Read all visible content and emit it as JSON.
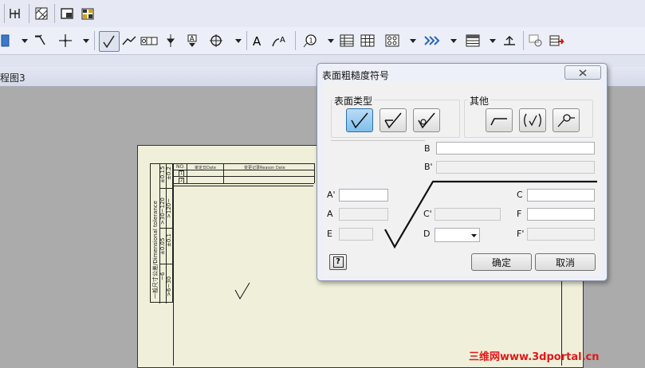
{
  "document": {
    "title": "程图3"
  },
  "dialog": {
    "title": "表面粗糙度符号",
    "group_surface_type": "表面类型",
    "group_other": "其他",
    "labels": {
      "b": "B",
      "b_prime": "B'",
      "a_prime": "A'",
      "a": "A",
      "e": "E",
      "c": "C",
      "c_prime": "C'",
      "d": "D",
      "f": "F",
      "f_prime": "F'"
    },
    "ok_label": "确定",
    "cancel_label": "取消",
    "help_label": "?"
  },
  "drawing": {
    "title_block": {
      "no_header": "NO.",
      "date_header": "审定日Date",
      "reason_header": "变更记录Reason Date",
      "row1": "1",
      "row2": "2"
    },
    "tolerance": {
      "title": "一般尺寸公差/Dimensional tolerance",
      "c1_range": ">6~30",
      "c1_tol": "~6",
      "c2_range": "",
      "c2_tol": "±0.05",
      "c3_tol": "±0.1",
      "c4_range": ">30~120",
      "c4_tol": ">120~",
      "c5_tol": "±0.15",
      "c6_tol": "±0.2"
    }
  },
  "watermark": "三维网www.3dportal.cn"
}
